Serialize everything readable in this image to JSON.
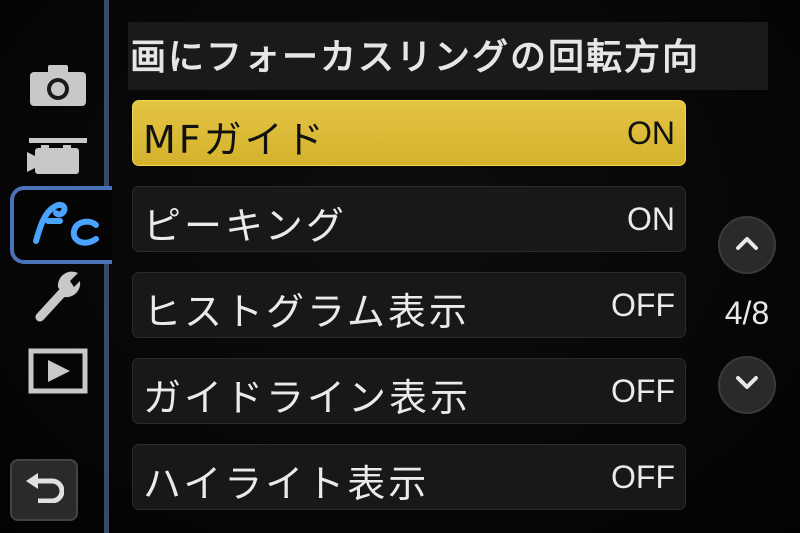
{
  "header": {
    "title": "画にフォーカスリングの回転方向"
  },
  "sidebar": {
    "items": [
      {
        "icon": "camera-icon"
      },
      {
        "icon": "video-camera-icon"
      },
      {
        "icon": "custom-settings-icon",
        "active": true
      },
      {
        "icon": "wrench-icon"
      },
      {
        "icon": "playback-icon"
      }
    ],
    "back": {
      "icon": "back-arrow-icon"
    }
  },
  "menu": {
    "items": [
      {
        "label": "MFガイド",
        "value": "ON",
        "selected": true
      },
      {
        "label": "ピーキング",
        "value": "ON"
      },
      {
        "label": "ヒストグラム表示",
        "value": "OFF"
      },
      {
        "label": "ガイドライン表示",
        "value": "OFF"
      },
      {
        "label": "ハイライト表示",
        "value": "OFF"
      }
    ]
  },
  "pager": {
    "page": "4/8",
    "up_icon": "chevron-up-icon",
    "down_icon": "chevron-down-icon"
  },
  "colors": {
    "accent": "#4a72b8",
    "selection": "#d9b935",
    "background": "#050505"
  }
}
